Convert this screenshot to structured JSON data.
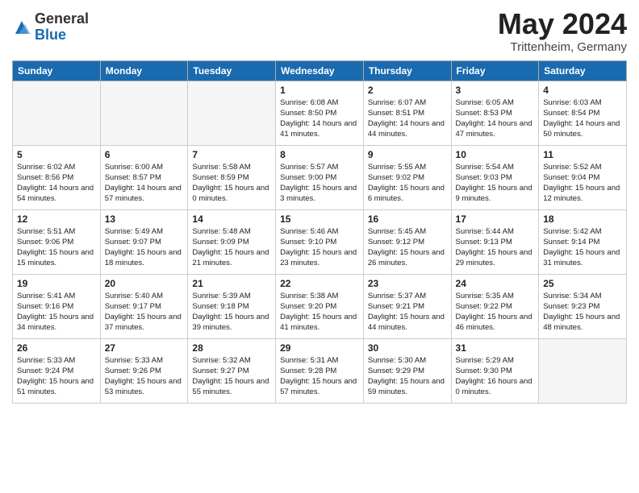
{
  "header": {
    "logo": {
      "general": "General",
      "blue": "Blue"
    },
    "title": "May 2024",
    "subtitle": "Trittenheim, Germany"
  },
  "columns": [
    "Sunday",
    "Monday",
    "Tuesday",
    "Wednesday",
    "Thursday",
    "Friday",
    "Saturday"
  ],
  "weeks": [
    [
      {
        "day": "",
        "empty": true
      },
      {
        "day": "",
        "empty": true
      },
      {
        "day": "",
        "empty": true
      },
      {
        "day": "1",
        "info": "Sunrise: 6:08 AM\nSunset: 8:50 PM\nDaylight: 14 hours\nand 41 minutes."
      },
      {
        "day": "2",
        "info": "Sunrise: 6:07 AM\nSunset: 8:51 PM\nDaylight: 14 hours\nand 44 minutes."
      },
      {
        "day": "3",
        "info": "Sunrise: 6:05 AM\nSunset: 8:53 PM\nDaylight: 14 hours\nand 47 minutes."
      },
      {
        "day": "4",
        "info": "Sunrise: 6:03 AM\nSunset: 8:54 PM\nDaylight: 14 hours\nand 50 minutes."
      }
    ],
    [
      {
        "day": "5",
        "info": "Sunrise: 6:02 AM\nSunset: 8:56 PM\nDaylight: 14 hours\nand 54 minutes."
      },
      {
        "day": "6",
        "info": "Sunrise: 6:00 AM\nSunset: 8:57 PM\nDaylight: 14 hours\nand 57 minutes."
      },
      {
        "day": "7",
        "info": "Sunrise: 5:58 AM\nSunset: 8:59 PM\nDaylight: 15 hours\nand 0 minutes."
      },
      {
        "day": "8",
        "info": "Sunrise: 5:57 AM\nSunset: 9:00 PM\nDaylight: 15 hours\nand 3 minutes."
      },
      {
        "day": "9",
        "info": "Sunrise: 5:55 AM\nSunset: 9:02 PM\nDaylight: 15 hours\nand 6 minutes."
      },
      {
        "day": "10",
        "info": "Sunrise: 5:54 AM\nSunset: 9:03 PM\nDaylight: 15 hours\nand 9 minutes."
      },
      {
        "day": "11",
        "info": "Sunrise: 5:52 AM\nSunset: 9:04 PM\nDaylight: 15 hours\nand 12 minutes."
      }
    ],
    [
      {
        "day": "12",
        "info": "Sunrise: 5:51 AM\nSunset: 9:06 PM\nDaylight: 15 hours\nand 15 minutes."
      },
      {
        "day": "13",
        "info": "Sunrise: 5:49 AM\nSunset: 9:07 PM\nDaylight: 15 hours\nand 18 minutes."
      },
      {
        "day": "14",
        "info": "Sunrise: 5:48 AM\nSunset: 9:09 PM\nDaylight: 15 hours\nand 21 minutes."
      },
      {
        "day": "15",
        "info": "Sunrise: 5:46 AM\nSunset: 9:10 PM\nDaylight: 15 hours\nand 23 minutes."
      },
      {
        "day": "16",
        "info": "Sunrise: 5:45 AM\nSunset: 9:12 PM\nDaylight: 15 hours\nand 26 minutes."
      },
      {
        "day": "17",
        "info": "Sunrise: 5:44 AM\nSunset: 9:13 PM\nDaylight: 15 hours\nand 29 minutes."
      },
      {
        "day": "18",
        "info": "Sunrise: 5:42 AM\nSunset: 9:14 PM\nDaylight: 15 hours\nand 31 minutes."
      }
    ],
    [
      {
        "day": "19",
        "info": "Sunrise: 5:41 AM\nSunset: 9:16 PM\nDaylight: 15 hours\nand 34 minutes."
      },
      {
        "day": "20",
        "info": "Sunrise: 5:40 AM\nSunset: 9:17 PM\nDaylight: 15 hours\nand 37 minutes."
      },
      {
        "day": "21",
        "info": "Sunrise: 5:39 AM\nSunset: 9:18 PM\nDaylight: 15 hours\nand 39 minutes."
      },
      {
        "day": "22",
        "info": "Sunrise: 5:38 AM\nSunset: 9:20 PM\nDaylight: 15 hours\nand 41 minutes."
      },
      {
        "day": "23",
        "info": "Sunrise: 5:37 AM\nSunset: 9:21 PM\nDaylight: 15 hours\nand 44 minutes."
      },
      {
        "day": "24",
        "info": "Sunrise: 5:35 AM\nSunset: 9:22 PM\nDaylight: 15 hours\nand 46 minutes."
      },
      {
        "day": "25",
        "info": "Sunrise: 5:34 AM\nSunset: 9:23 PM\nDaylight: 15 hours\nand 48 minutes."
      }
    ],
    [
      {
        "day": "26",
        "info": "Sunrise: 5:33 AM\nSunset: 9:24 PM\nDaylight: 15 hours\nand 51 minutes."
      },
      {
        "day": "27",
        "info": "Sunrise: 5:33 AM\nSunset: 9:26 PM\nDaylight: 15 hours\nand 53 minutes."
      },
      {
        "day": "28",
        "info": "Sunrise: 5:32 AM\nSunset: 9:27 PM\nDaylight: 15 hours\nand 55 minutes."
      },
      {
        "day": "29",
        "info": "Sunrise: 5:31 AM\nSunset: 9:28 PM\nDaylight: 15 hours\nand 57 minutes."
      },
      {
        "day": "30",
        "info": "Sunrise: 5:30 AM\nSunset: 9:29 PM\nDaylight: 15 hours\nand 59 minutes."
      },
      {
        "day": "31",
        "info": "Sunrise: 5:29 AM\nSunset: 9:30 PM\nDaylight: 16 hours\nand 0 minutes."
      },
      {
        "day": "",
        "empty": true
      }
    ]
  ]
}
